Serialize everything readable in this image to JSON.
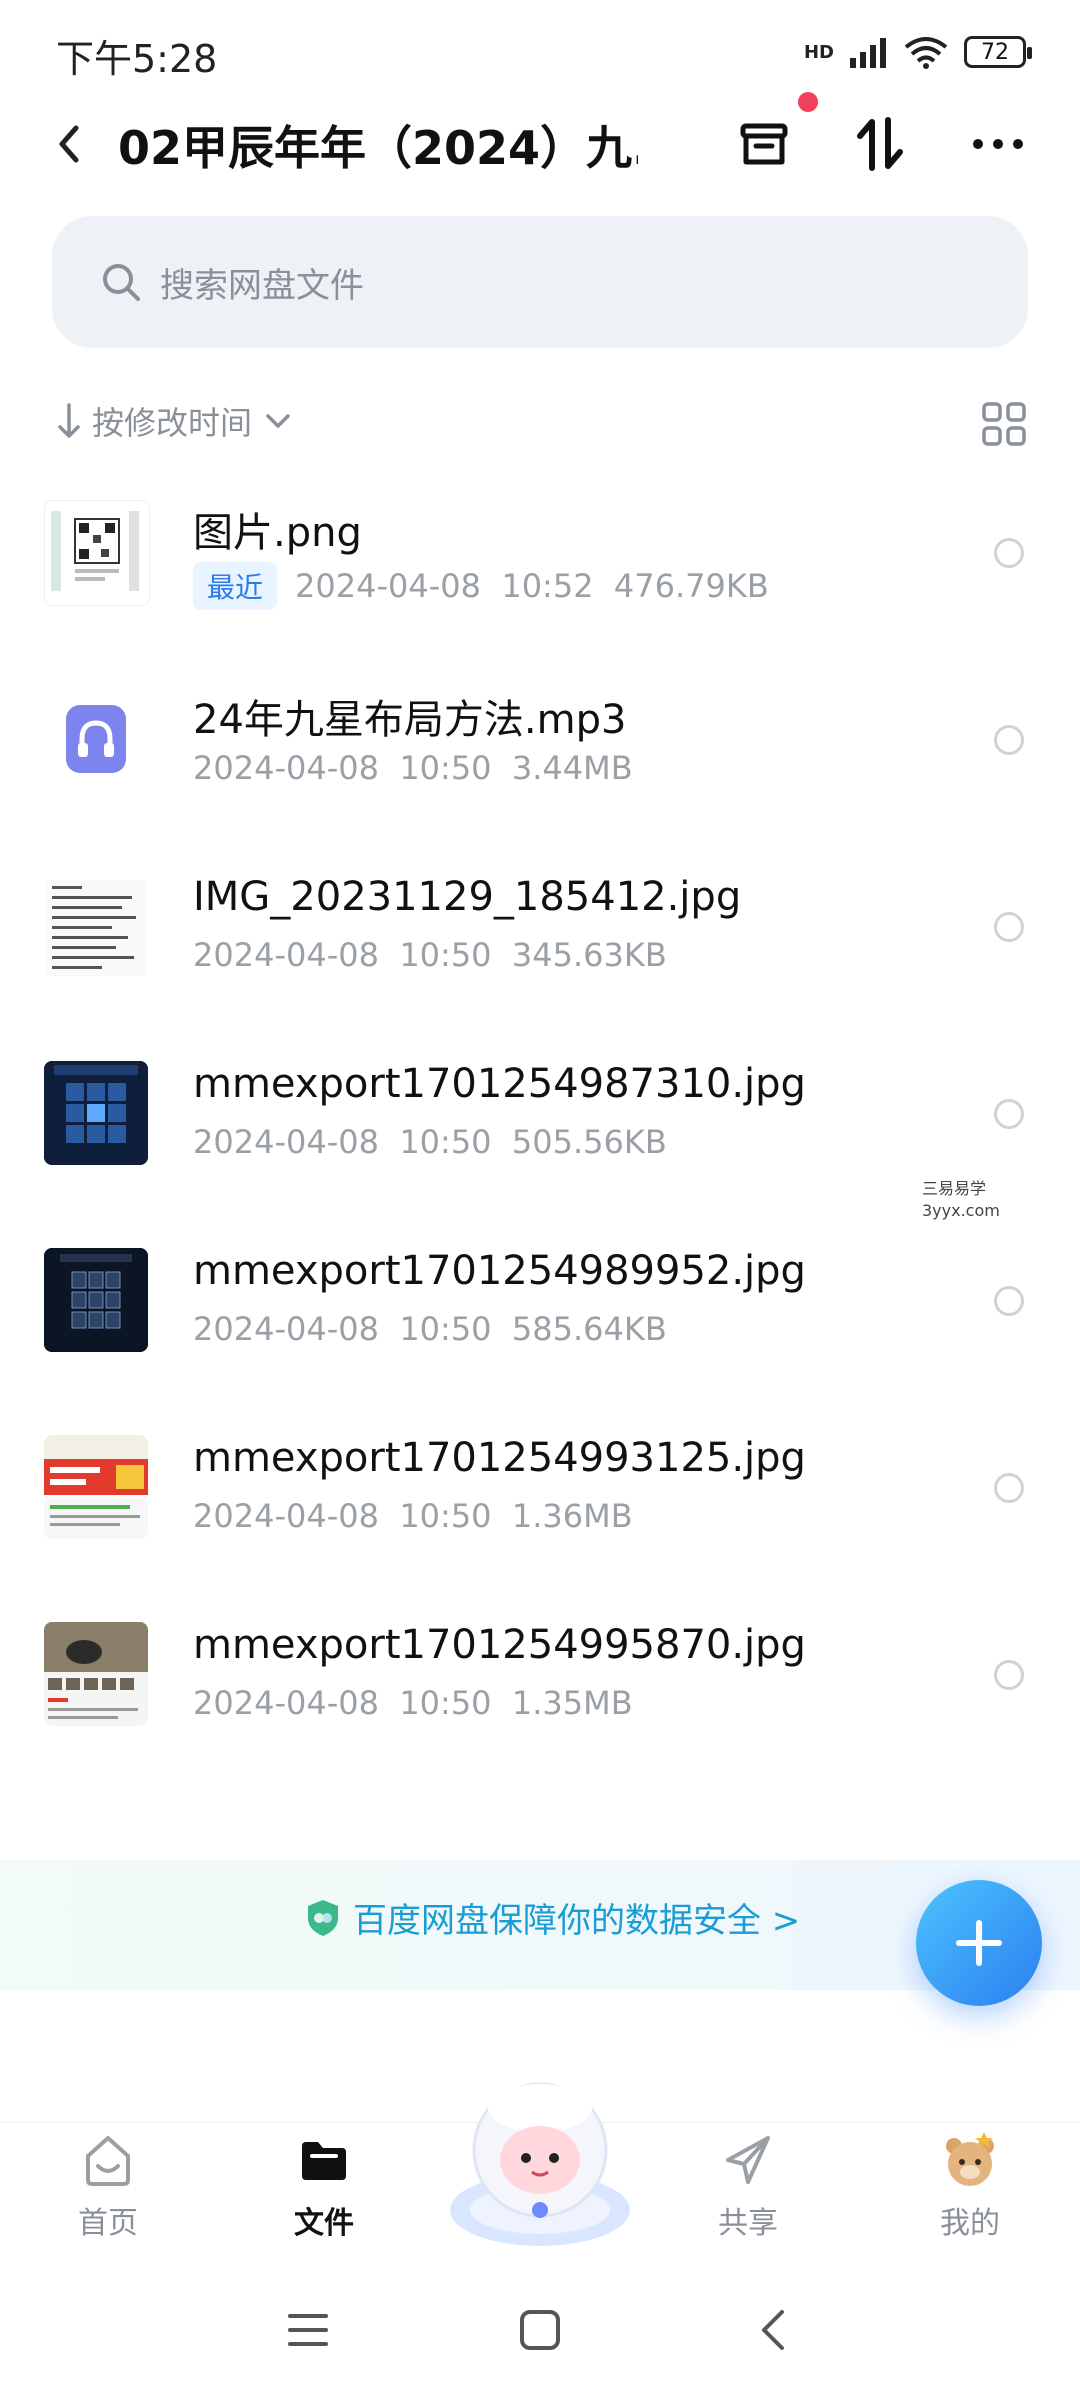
{
  "status_bar": {
    "time": "下午5:28",
    "network": "HD",
    "battery": "72"
  },
  "header": {
    "title": "02甲辰年年（2024）九...",
    "icons": [
      "back-arrow-icon",
      "archive-box-icon",
      "sort-arrows-icon",
      "more-dots-icon"
    ]
  },
  "search": {
    "placeholder": "搜索网盘文件"
  },
  "sort": {
    "label": "按修改时间"
  },
  "files": [
    {
      "name": "图片.png",
      "badge": "最近",
      "date": "2024-04-08",
      "time": "10:52",
      "size": "476.79KB",
      "thumb": "qr-image"
    },
    {
      "name": "24年九星布局方法.mp3",
      "badge": "",
      "date": "2024-04-08",
      "time": "10:50",
      "size": "3.44MB",
      "thumb": "audio"
    },
    {
      "name": "IMG_20231129_185412.jpg",
      "badge": "",
      "date": "2024-04-08",
      "time": "10:50",
      "size": "345.63KB",
      "thumb": "text-doc"
    },
    {
      "name": "mmexport1701254987310.jpg",
      "badge": "",
      "date": "2024-04-08",
      "time": "10:50",
      "size": "505.56KB",
      "thumb": "blue-grid"
    },
    {
      "name": "mmexport1701254989952.jpg",
      "badge": "",
      "date": "2024-04-08",
      "time": "10:50",
      "size": "585.64KB",
      "thumb": "dark-grid"
    },
    {
      "name": "mmexport1701254993125.jpg",
      "badge": "",
      "date": "2024-04-08",
      "time": "10:50",
      "size": "1.36MB",
      "thumb": "red-promo"
    },
    {
      "name": "mmexport1701254995870.jpg",
      "badge": "",
      "date": "2024-04-08",
      "time": "10:50",
      "size": "1.35MB",
      "thumb": "product-photo"
    }
  ],
  "watermark": {
    "line1": "三易易学",
    "line2": "3yyx.com"
  },
  "safety_banner": {
    "text": "百度网盘保障你的数据安全 >"
  },
  "bottom_nav": {
    "tabs": [
      {
        "label": "首页",
        "active": false
      },
      {
        "label": "文件",
        "active": true
      },
      {
        "label": "共享",
        "active": false
      },
      {
        "label": "我的",
        "active": false
      }
    ]
  },
  "colors": {
    "accent": "#2b7ff0",
    "recent_badge_bg": "#e8f4ff",
    "recent_badge_text": "#2d7be8",
    "banner_text": "#1a9dd4",
    "notification_dot": "#f0405a"
  }
}
